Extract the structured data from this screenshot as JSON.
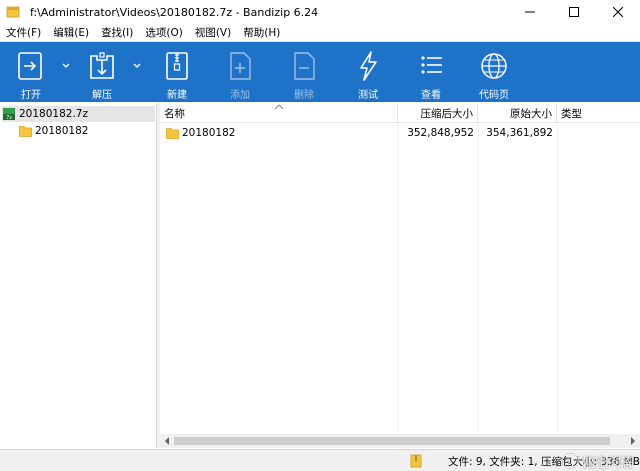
{
  "window": {
    "title": "f:\\Administrator\\Videos\\20180182.7z - Bandizip 6.24"
  },
  "menu": [
    {
      "label": "文件(F)"
    },
    {
      "label": "编辑(E)"
    },
    {
      "label": "查找(I)"
    },
    {
      "label": "选项(O)"
    },
    {
      "label": "视图(V)"
    },
    {
      "label": "帮助(H)"
    }
  ],
  "toolbar": {
    "open": "打开",
    "extract": "解压",
    "new": "新建",
    "add": "添加",
    "delete": "删除",
    "test": "测试",
    "view": "查看",
    "codepage": "代码页"
  },
  "tree": {
    "archive": "20180182.7z",
    "folder": "20180182"
  },
  "list": {
    "columns": {
      "name": "名称",
      "packed": "压缩后大小",
      "original": "原始大小",
      "type": "类型"
    },
    "rows": [
      {
        "name": "20180182",
        "packed": "352,848,952",
        "original": "354,361,892",
        "type": ""
      }
    ]
  },
  "status": {
    "text": "文件: 9, 文件夹: 1, 压缩包大小: 336 MB"
  },
  "watermark": {
    "text": "悟空问答"
  },
  "colors": {
    "toolbar": "#1e73c8",
    "folder": "#f5c542"
  }
}
